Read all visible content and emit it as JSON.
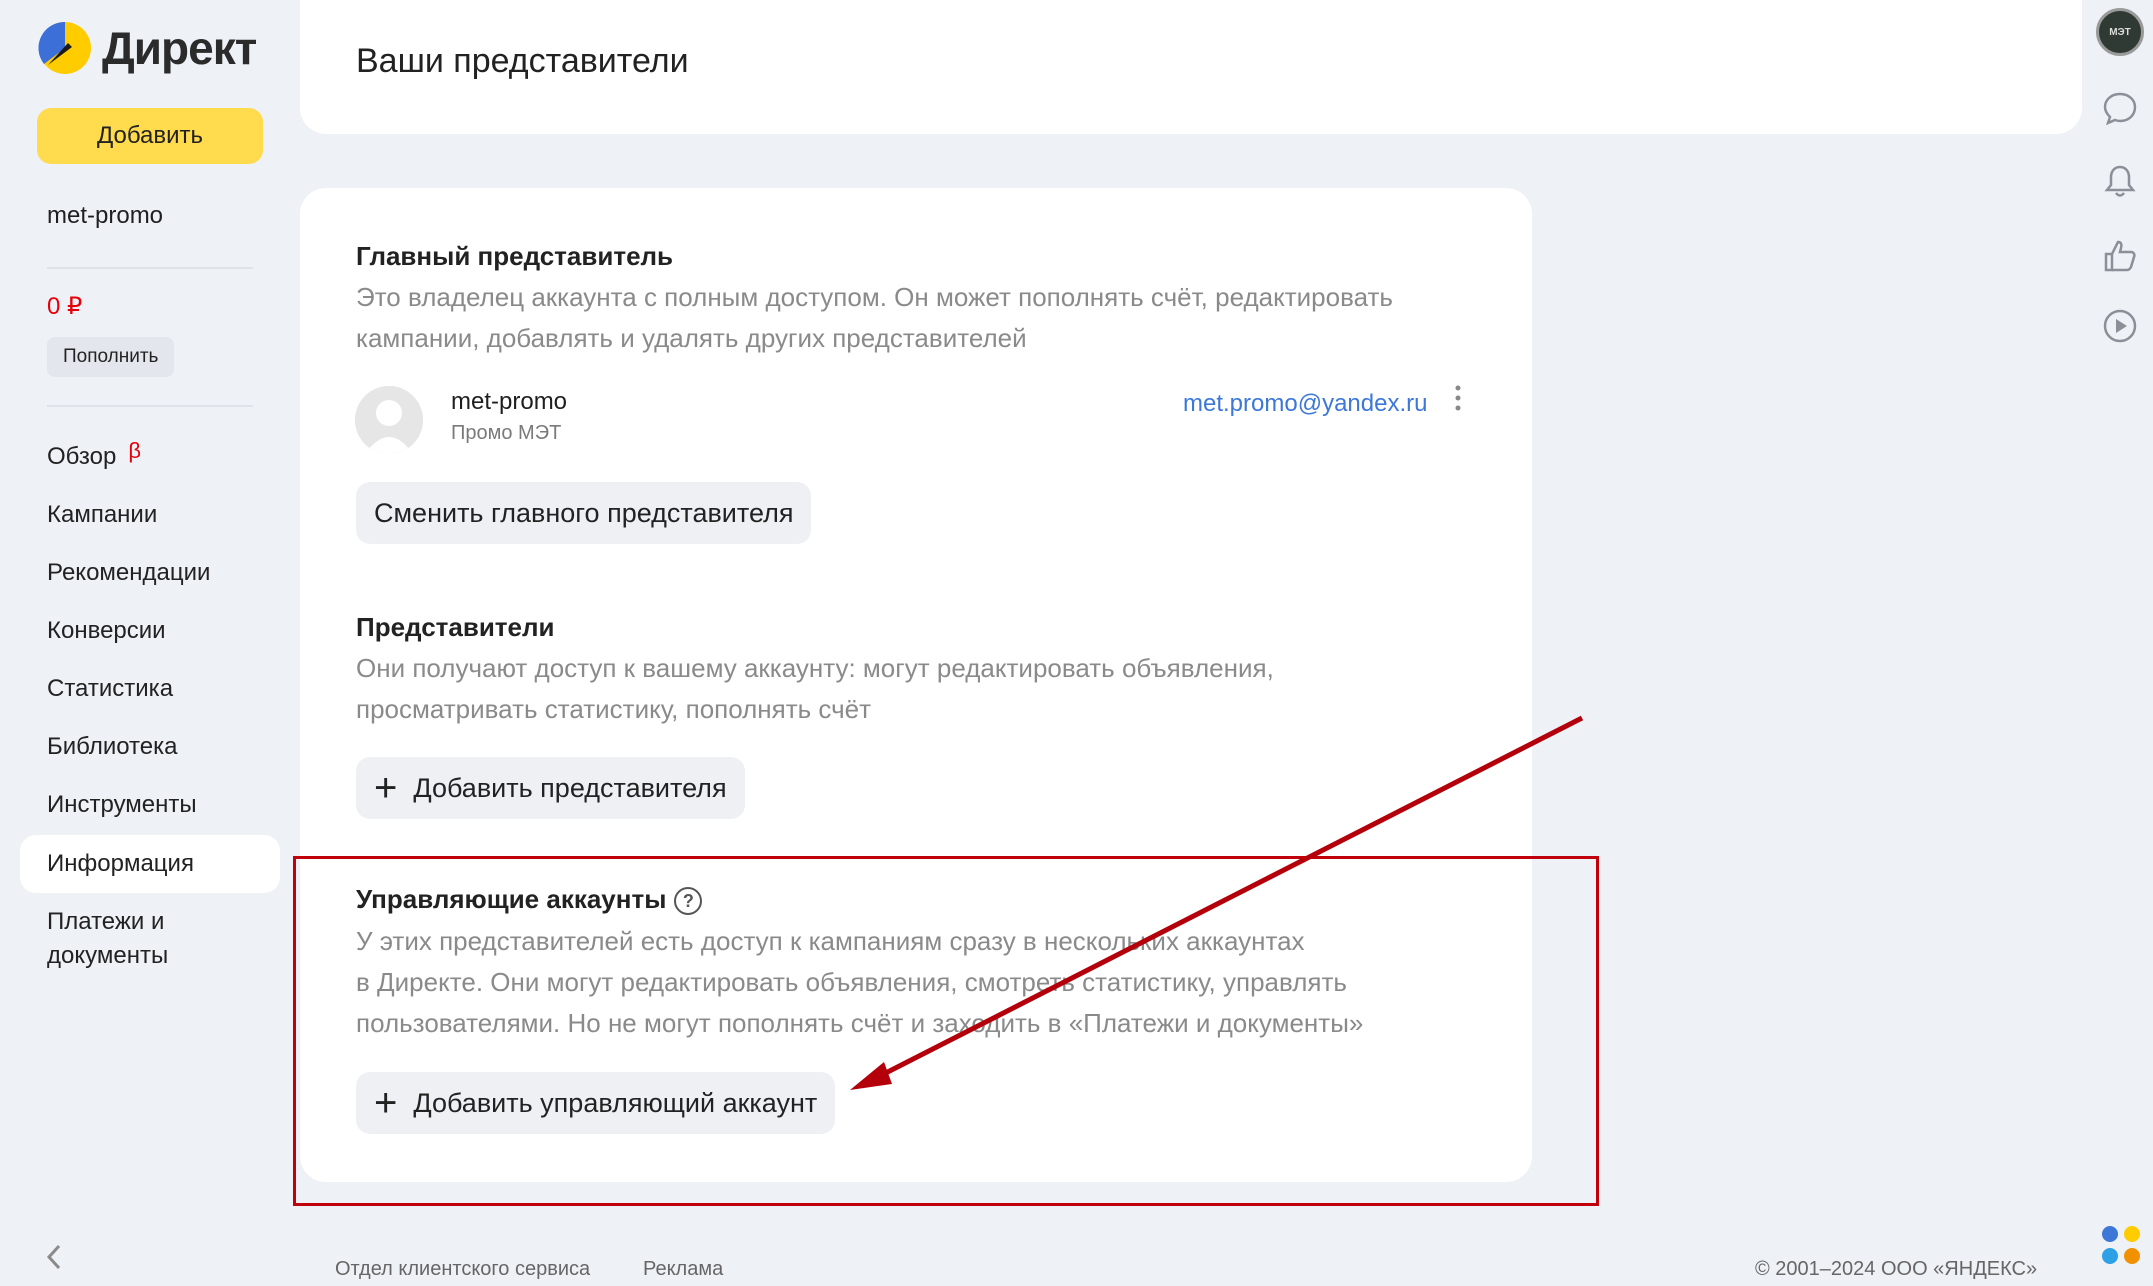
{
  "sidebar": {
    "logo_text": "Директ",
    "add_button": "Добавить",
    "account": "met-promo",
    "balance": "0 ₽",
    "topup_button": "Пополнить",
    "nav": [
      {
        "label": "Обзор",
        "badge": "β"
      },
      {
        "label": "Кампании"
      },
      {
        "label": "Рекомендации"
      },
      {
        "label": "Конверсии"
      },
      {
        "label": "Статистика"
      },
      {
        "label": "Библиотека"
      },
      {
        "label": "Инструменты"
      },
      {
        "label": "Информация",
        "active": true
      },
      {
        "label": "Платежи и\nдокументы"
      }
    ],
    "collapse_icon": "chevron-left-icon"
  },
  "header": {
    "title": "Ваши представители"
  },
  "main_rep": {
    "title": "Главный представитель",
    "desc_line1": "Это владелец аккаунта с полным доступом. Он может пополнять счёт, редактировать",
    "desc_line2": "кампании, добавлять и удалять других представителей",
    "name": "met-promo",
    "org": "Промо МЭТ",
    "email": "met.promo@yandex.ru",
    "change_button": "Сменить главного представителя"
  },
  "reps": {
    "title": "Представители",
    "desc_line1": "Они получают доступ к вашему аккаунту: могут редактировать объявления,",
    "desc_line2": "просматривать статистику, пополнять счёт",
    "add_button": "Добавить представителя"
  },
  "managing": {
    "title": "Управляющие аккаунты",
    "help": "?",
    "desc_line1": "У этих представителей есть доступ к кампаниям сразу в нескольких аккаунтах",
    "desc_line2": "в Директе. Они могут редактировать объявления, смотреть статистику, управлять",
    "desc_line3": "пользователями. Но не могут пополнять счёт и заходить в «Платежи и документы»",
    "add_button": "Добавить управляющий аккаунт"
  },
  "footer": {
    "support": "Отдел клиентского сервиса",
    "ads": "Реклама",
    "copyright": "© 2001–2024  ООО «ЯНДЕКС»"
  },
  "profile_avatar_text": "МЭТ",
  "colors": {
    "accent_yellow": "#ffdb4d",
    "link_blue": "#3d78d8",
    "annotation_red": "#c0000a",
    "balance_red": "#e6000a"
  }
}
